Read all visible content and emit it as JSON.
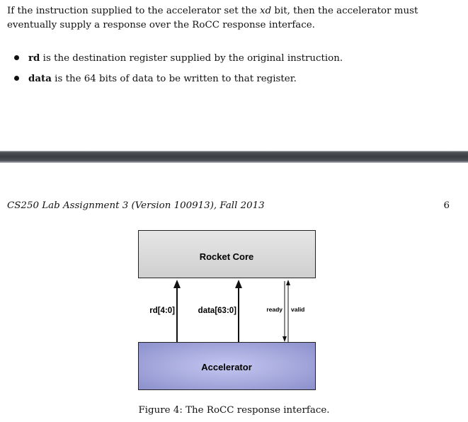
{
  "paragraph": {
    "before": "If the instruction supplied to the accelerator set the ",
    "xd": "xd",
    "after": " bit, then the accelerator must eventually supply a response over the RoCC response interface."
  },
  "bullets": [
    {
      "term": "rd",
      "text": " is the destination register supplied by the original instruction."
    },
    {
      "term": "data",
      "text": " is the 64 bits of data to be written to that register."
    }
  ],
  "running_head": "CS250 Lab Assignment 3 (Version 100913), Fall 2013",
  "page_number": "6",
  "figure": {
    "top_box": "Rocket Core",
    "bottom_box": "Accelerator",
    "signal_rd": "rd[4:0]",
    "signal_data": "data[63:0]",
    "signal_ready": "ready",
    "signal_valid": "valid",
    "colors": {
      "top_fill": "#d9d9d9",
      "bottom_fill": "#9a9ed6",
      "bottom_center": "#c4c7f0"
    }
  },
  "caption": "Figure 4: The RoCC response interface."
}
